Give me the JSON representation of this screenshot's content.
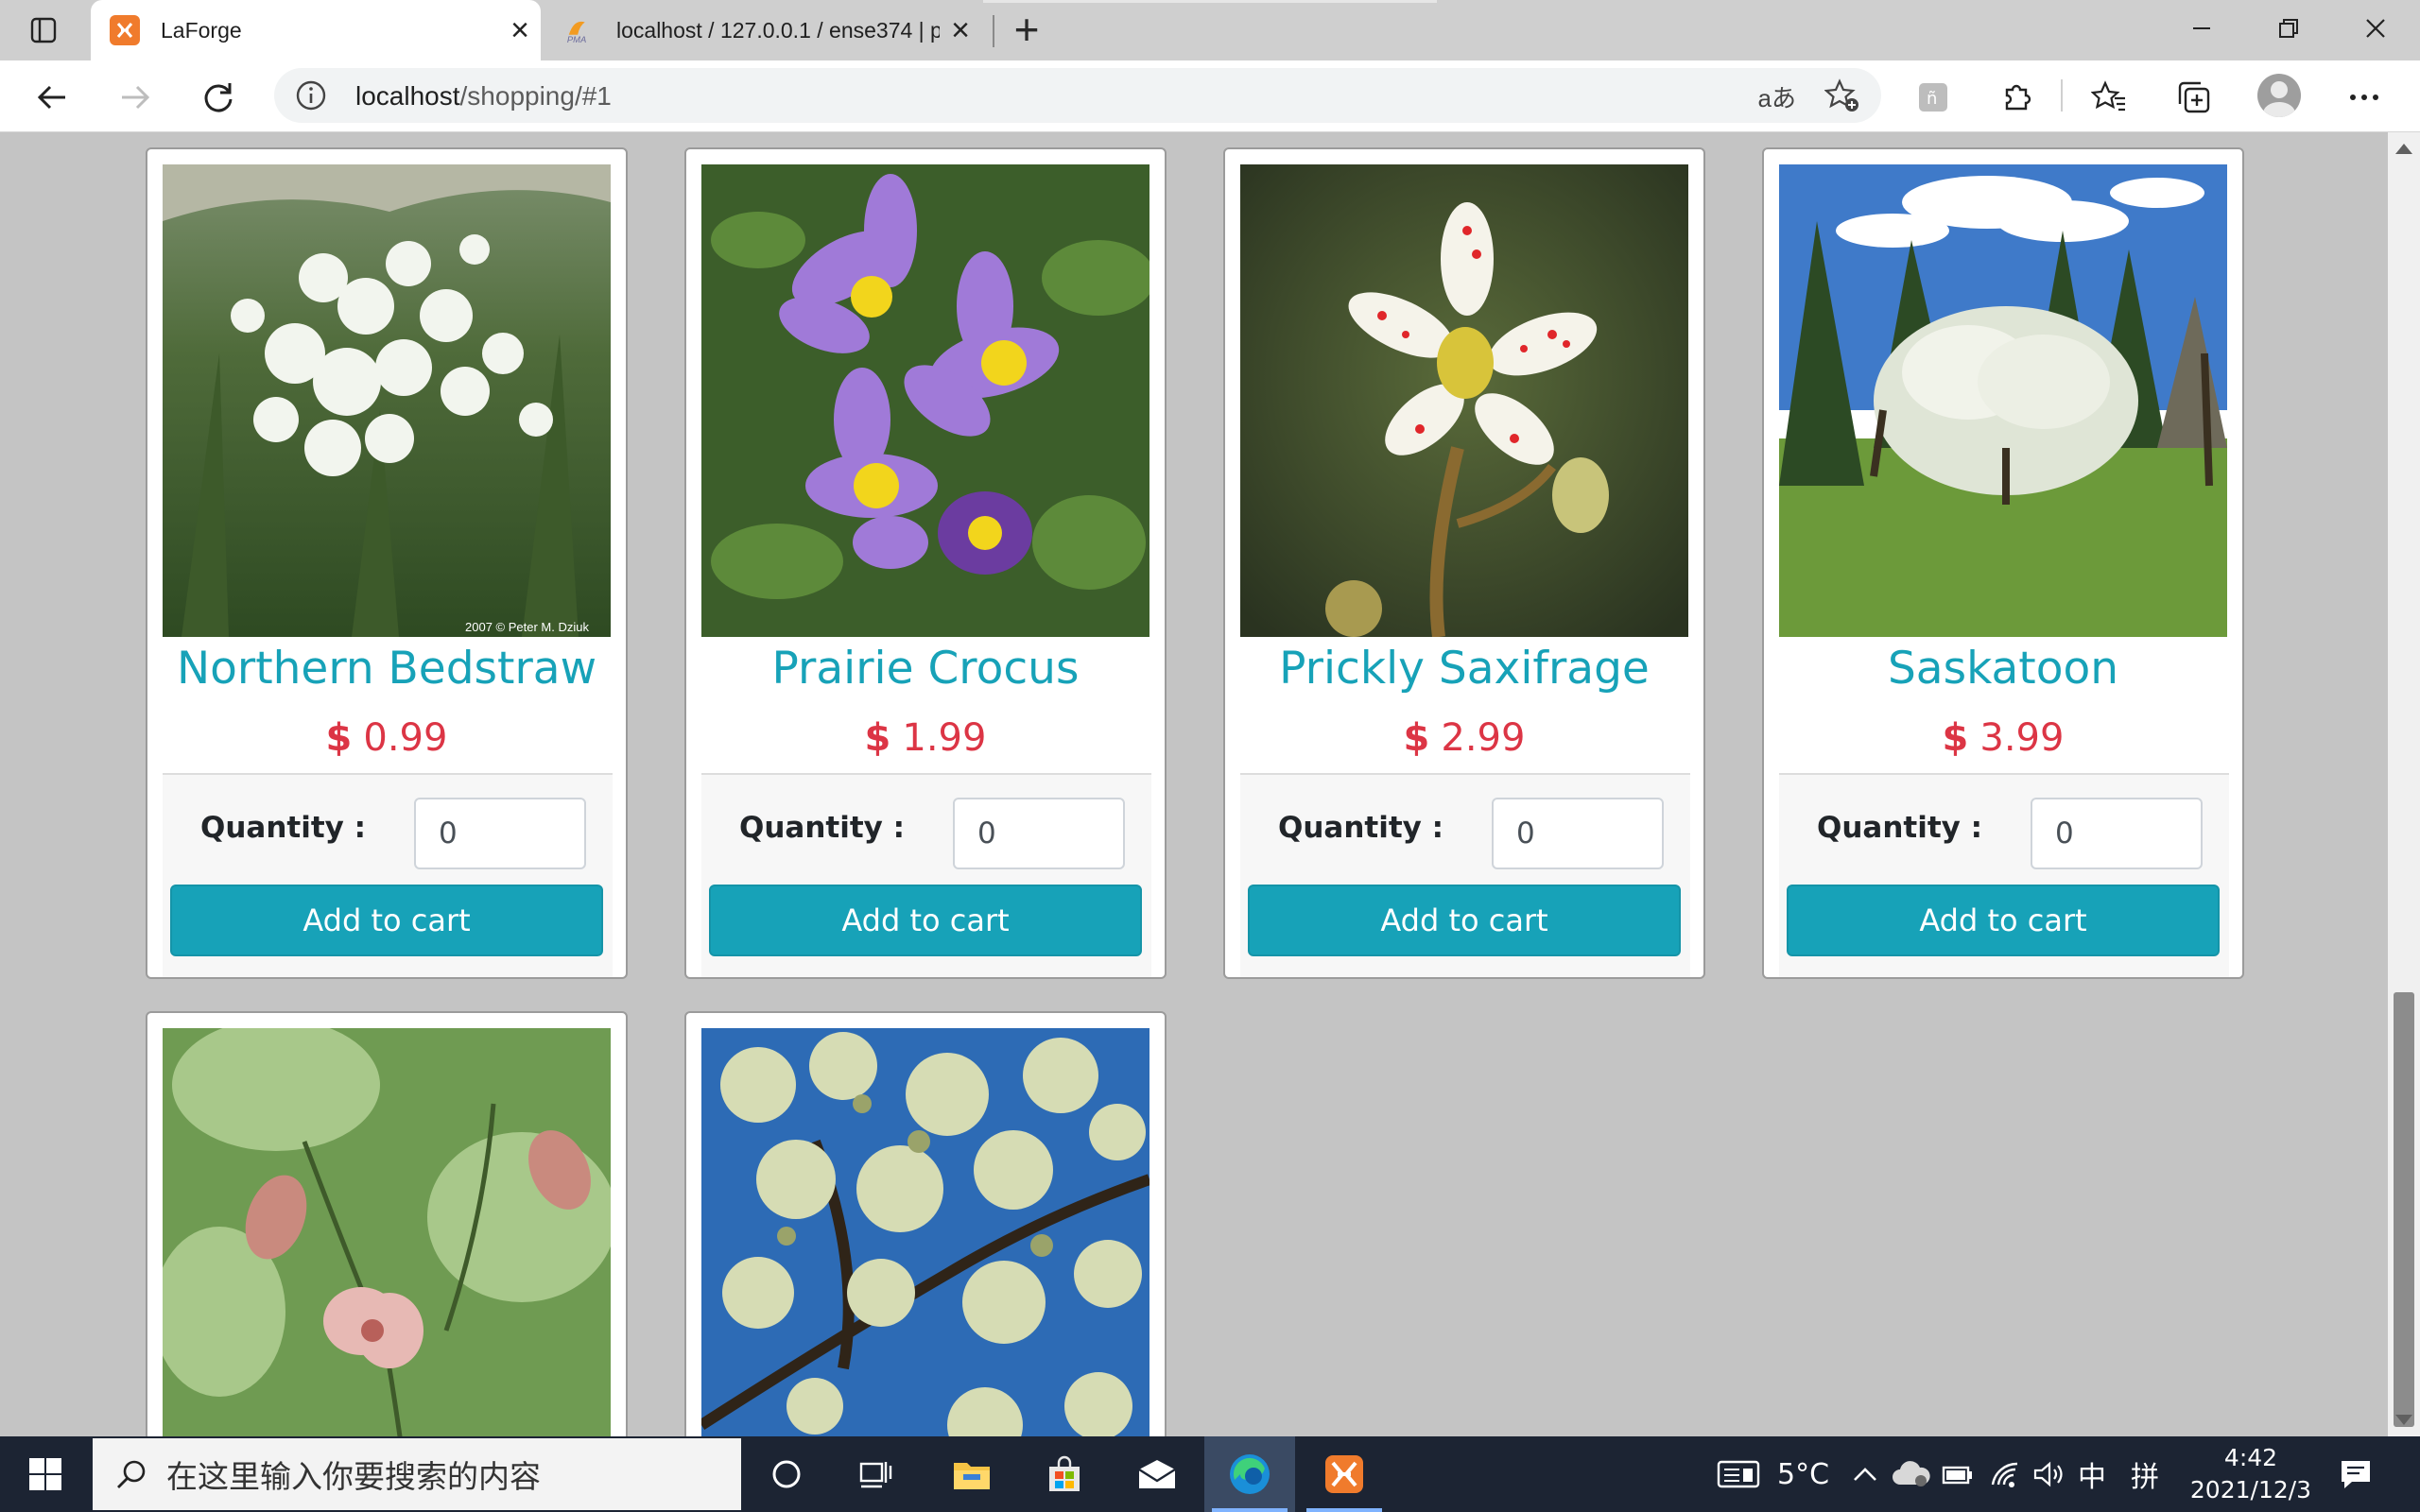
{
  "browser": {
    "tabs": [
      {
        "title": "LaForge",
        "active": true
      },
      {
        "title": "localhost / 127.0.0.1 / ense374 | p",
        "active": false
      }
    ],
    "url": {
      "host": "localhost",
      "path": "/shopping/#1"
    }
  },
  "products": [
    {
      "name": "Northern Bedstraw",
      "currency": "$",
      "price": "0.99",
      "quantity_label": "Quantity :",
      "quantity": "0",
      "button": "Add to cart",
      "image_caption": "2007 © Peter M. Dziuk"
    },
    {
      "name": "Prairie Crocus",
      "currency": "$",
      "price": "1.99",
      "quantity_label": "Quantity :",
      "quantity": "0",
      "button": "Add to cart"
    },
    {
      "name": "Prickly Saxifrage",
      "currency": "$",
      "price": "2.99",
      "quantity_label": "Quantity :",
      "quantity": "0",
      "button": "Add to cart"
    },
    {
      "name": "Saskatoon",
      "currency": "$",
      "price": "3.99",
      "quantity_label": "Quantity :",
      "quantity": "0",
      "button": "Add to cart"
    }
  ],
  "colors": {
    "accent": "#17a2b8",
    "price": "#dc3545",
    "taskbar": "#1c2433"
  },
  "taskbar": {
    "search_placeholder": "在这里输入你要搜索的内容",
    "weather": "5°C",
    "ime_lang": "中",
    "ime_mode": "拼",
    "time": "4:42",
    "date": "2021/12/3"
  }
}
